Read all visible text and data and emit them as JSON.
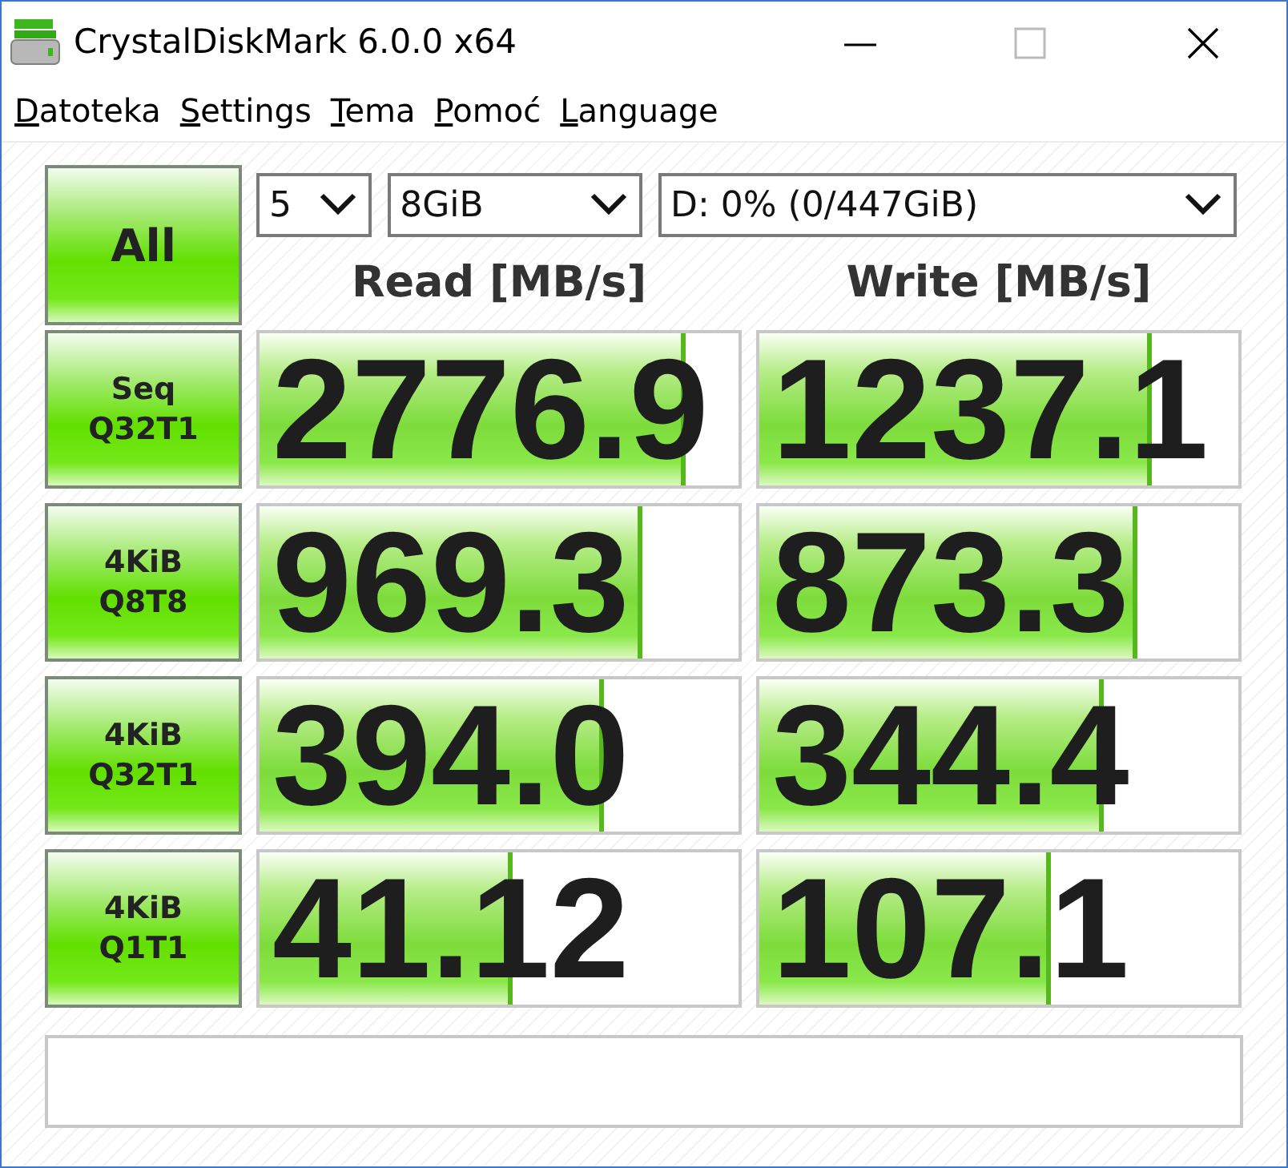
{
  "window": {
    "title": "CrystalDiskMark 6.0.0 x64"
  },
  "menu": [
    "Datoteka",
    "Settings",
    "Tema",
    "Pomoć",
    "Language"
  ],
  "all_button": "All",
  "selectors": {
    "count": "5",
    "size": "8GiB",
    "drive": "D: 0% (0/447GiB)"
  },
  "columns": [
    "Read [MB/s]",
    "Write [MB/s]"
  ],
  "tests": [
    {
      "label": "Seq\nQ32T1",
      "read": {
        "value": "2776.9",
        "level": 0.88
      },
      "write": {
        "value": "1237.1",
        "level": 0.81
      }
    },
    {
      "label": "4KiB\nQ8T8",
      "read": {
        "value": "969.3",
        "level": 0.79
      },
      "write": {
        "value": "873.3",
        "level": 0.78
      }
    },
    {
      "label": "4KiB\nQ32T1",
      "read": {
        "value": "394.0",
        "level": 0.71
      },
      "write": {
        "value": "344.4",
        "level": 0.71
      }
    },
    {
      "label": "4KiB\nQ1T1",
      "read": {
        "value": "41.12",
        "level": 0.52
      },
      "write": {
        "value": "107.1",
        "level": 0.6
      }
    }
  ]
}
